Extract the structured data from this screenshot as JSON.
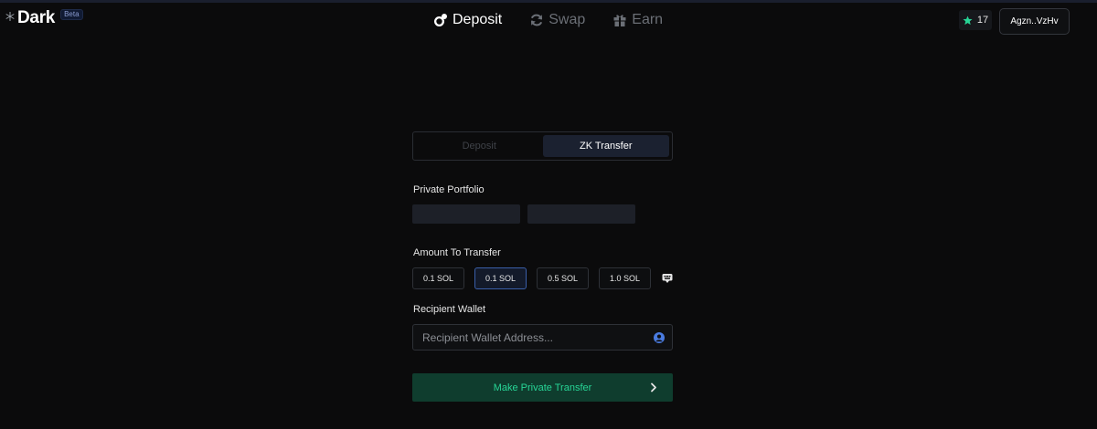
{
  "header": {
    "logo_text": "Dark",
    "beta_label": "Beta",
    "nav": [
      {
        "label": "Deposit",
        "icon": "deposit-icon",
        "active": true
      },
      {
        "label": "Swap",
        "icon": "swap-icon",
        "active": false
      },
      {
        "label": "Earn",
        "icon": "gift-icon",
        "active": false
      }
    ],
    "star_count": "17",
    "wallet_label": "Agzn..VzHv"
  },
  "panel": {
    "tabs": [
      {
        "label": "Deposit",
        "active": false
      },
      {
        "label": "ZK Transfer",
        "active": true
      }
    ],
    "portfolio_label": "Private Portfolio",
    "amount_label": "Amount To Transfer",
    "amounts": [
      {
        "label": "0.1 SOL",
        "selected": false
      },
      {
        "label": "0.1 SOL",
        "selected": true
      },
      {
        "label": "0.5 SOL",
        "selected": false
      },
      {
        "label": "1.0 SOL",
        "selected": false
      }
    ],
    "recipient_label": "Recipient Wallet",
    "recipient_placeholder": "Recipient Wallet Address...",
    "recipient_value": "",
    "cta_label": "Make Private Transfer"
  },
  "colors": {
    "background": "#0b0b0c",
    "accent_green": "#27d596",
    "cta_bg": "#0f3d2e",
    "selected_border": "#3a5ea8",
    "user_icon": "#4a7be0"
  }
}
